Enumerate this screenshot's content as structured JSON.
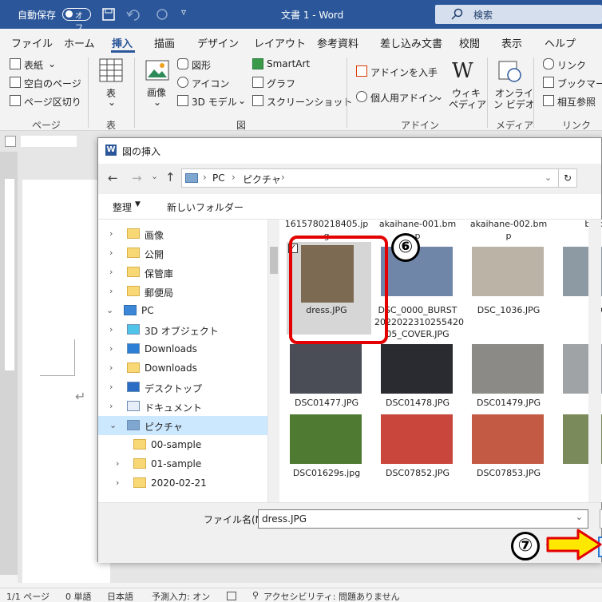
{
  "titlebar": {
    "autosave_label": "自動保存",
    "autosave_state": "オフ",
    "doc_title": "文書 1  -  Word",
    "search_placeholder": "検索"
  },
  "ribbon_tabs": [
    "ファイル",
    "ホーム",
    "挿入",
    "描画",
    "デザイン",
    "レイアウト",
    "参考資料",
    "差し込み文書",
    "校閲",
    "表示",
    "ヘルプ"
  ],
  "ribbon": {
    "pages": {
      "cover": "表紙",
      "blank": "空白のページ",
      "break": "ページ区切り",
      "group": "ページ"
    },
    "table": {
      "btn": "表",
      "group": "表"
    },
    "illust": {
      "image": "画像",
      "shapes": "図形",
      "icons": "アイコン",
      "model3d": "3D モデル",
      "smartart": "SmartArt",
      "graph": "グラフ",
      "screenshot": "スクリーンショット",
      "group": "図"
    },
    "addin": {
      "get": "アドインを入手",
      "personal": "個人用アドイン",
      "wiki1": "ウィキ",
      "wiki2": "ペディア",
      "group": "アドイン"
    },
    "media": {
      "video1": "オンライ",
      "video2": "ン ビデオ",
      "group": "メディア"
    },
    "links": {
      "link": "リンク",
      "bookmark": "ブックマーク",
      "xref": "相互参照",
      "group": "リンク"
    }
  },
  "dialog": {
    "title": "図の挿入",
    "breadcrumb": [
      "PC",
      "ピクチャ"
    ],
    "organize": "整理",
    "new_folder": "新しいフォルダー",
    "nav": [
      {
        "label": "画像",
        "type": "folder",
        "indent": 1,
        "chev": ">"
      },
      {
        "label": "公開",
        "type": "folder",
        "indent": 1,
        "chev": ">"
      },
      {
        "label": "保管庫",
        "type": "folder",
        "indent": 1,
        "chev": ">"
      },
      {
        "label": "郵便局",
        "type": "folder",
        "indent": 1,
        "chev": ">"
      },
      {
        "label": "PC",
        "type": "pc",
        "indent": 0,
        "chev": "v"
      },
      {
        "label": "3D オブジェクト",
        "type": "3d",
        "indent": 1,
        "chev": ">"
      },
      {
        "label": "Downloads",
        "type": "download",
        "indent": 1,
        "chev": ">"
      },
      {
        "label": "Downloads",
        "type": "folder",
        "indent": 1,
        "chev": ">"
      },
      {
        "label": "デスクトップ",
        "type": "desktop",
        "indent": 1,
        "chev": ">"
      },
      {
        "label": "ドキュメント",
        "type": "doc",
        "indent": 1,
        "chev": ">"
      },
      {
        "label": "ピクチャ",
        "type": "pictures",
        "indent": 1,
        "chev": "v",
        "selected": true
      },
      {
        "label": "00-sample",
        "type": "folder",
        "indent": 2,
        "chev": ""
      },
      {
        "label": "01-sample",
        "type": "folder",
        "indent": 2,
        "chev": ">"
      },
      {
        "label": "2020-02-21",
        "type": "folder",
        "indent": 2,
        "chev": ">"
      }
    ],
    "top_names": [
      {
        "l1": "1615780218405.jp",
        "l2": "g"
      },
      {
        "l1": "akaihane-001.bm",
        "l2": "p"
      },
      {
        "l1": "akaihane-002.bm",
        "l2": "p"
      },
      {
        "l1": "baioga",
        "l2": ""
      }
    ],
    "files": [
      {
        "name": "dress.JPG",
        "color": "#7d6a52",
        "sel": true
      },
      {
        "name": "DSC_0000_BURST20220223102554205_COVER.JPG",
        "l1": "DSC_0000_BURST",
        "l2": "2022022310255420",
        "l3": "05_COVER.JPG",
        "color": "#6f86a8"
      },
      {
        "name": "DSC_1036.JPG",
        "color": "#bbb3a6"
      },
      {
        "name": "DSC_",
        "color": "#8d9aa3"
      },
      {
        "name": "DSC01477.JPG",
        "color": "#4a4d55"
      },
      {
        "name": "DSC01478.JPG",
        "color": "#2a2b30"
      },
      {
        "name": "DSC01479.JPG",
        "color": "#8c8a86"
      },
      {
        "name": "",
        "color": "#9fa3a6"
      },
      {
        "name": "DSC01629s.jpg",
        "color": "#4f7a32"
      },
      {
        "name": "DSC07852.JPG",
        "color": "#c8463c"
      },
      {
        "name": "DSC07853.JPG",
        "color": "#c25a44"
      },
      {
        "name": "",
        "color": "#7a8a5a"
      }
    ],
    "filename_label": "ファイル名(N):",
    "filename_value": "dress.JPG"
  },
  "annotations": {
    "step6": "⑥",
    "step7": "⑦"
  },
  "statusbar": {
    "page": "1/1 ページ",
    "words": "0 単語",
    "lang": "日本語",
    "predict": "予測入力: オン",
    "access": "アクセシビリティ: 問題ありません"
  }
}
